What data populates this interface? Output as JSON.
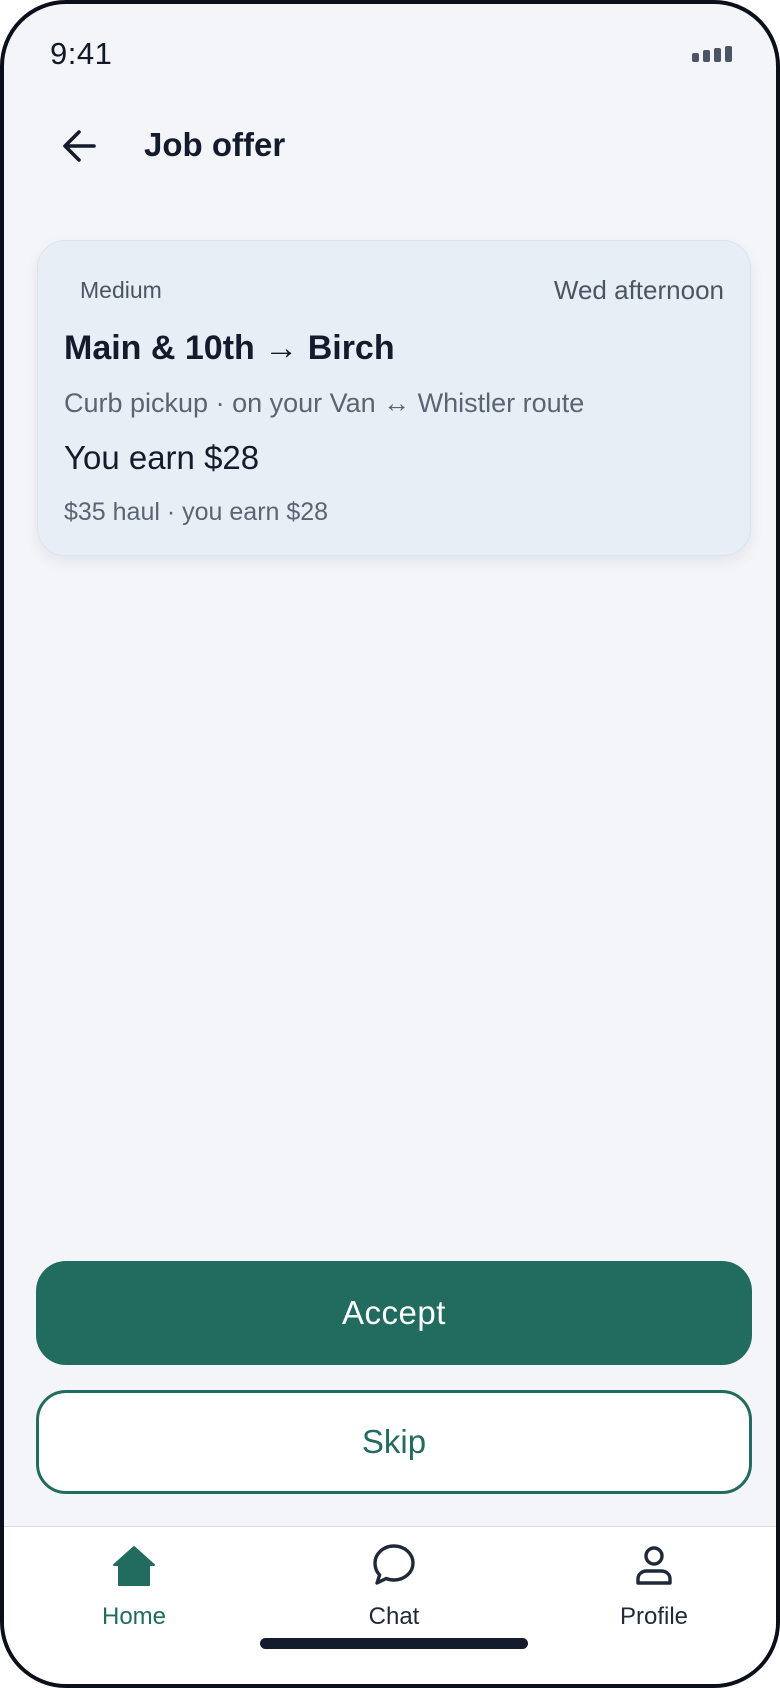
{
  "status_bar": {
    "time": "9:41",
    "signal_icon": "signal-bars-icon"
  },
  "header": {
    "title": "Job offer",
    "back_icon": "arrow-left-icon"
  },
  "job_card": {
    "badge": "Medium",
    "time_window": "Wed afternoon",
    "route": "Main & 10th → Birch",
    "description": "Curb pickup · on your Van ↔ Whistler route",
    "earnings": "You earn $28",
    "breakdown": "$35 haul · you earn $28"
  },
  "actions": {
    "accept_label": "Accept",
    "skip_label": "Skip"
  },
  "tab_bar": {
    "items": [
      {
        "label": "Home",
        "icon": "home-icon",
        "active": true
      },
      {
        "label": "Chat",
        "icon": "chat-bubble-icon",
        "active": false
      },
      {
        "label": "Profile",
        "icon": "user-icon",
        "active": false
      }
    ]
  },
  "colors": {
    "accent": "#216b5f",
    "background": "#f3f5f9",
    "card_background": "#e7eef6",
    "text_primary": "#141b2d",
    "text_secondary": "#5b6472"
  }
}
